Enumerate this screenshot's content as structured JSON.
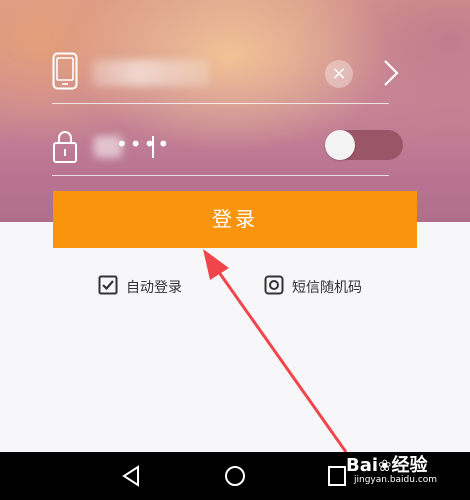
{
  "login_form": {
    "password_mask": "••••",
    "clear_symbol": "×",
    "login_button": "登录"
  },
  "options": {
    "auto_login": "自动登录",
    "sms_code": "短信随机码"
  },
  "watermark": {
    "brand": "Bai",
    "brand_suffix": "经验",
    "site": "jingyan.baidu.com"
  },
  "colors": {
    "accent": "#f9940c",
    "annotation_arrow": "#f0464b",
    "toggle_track": "#9a5566"
  }
}
